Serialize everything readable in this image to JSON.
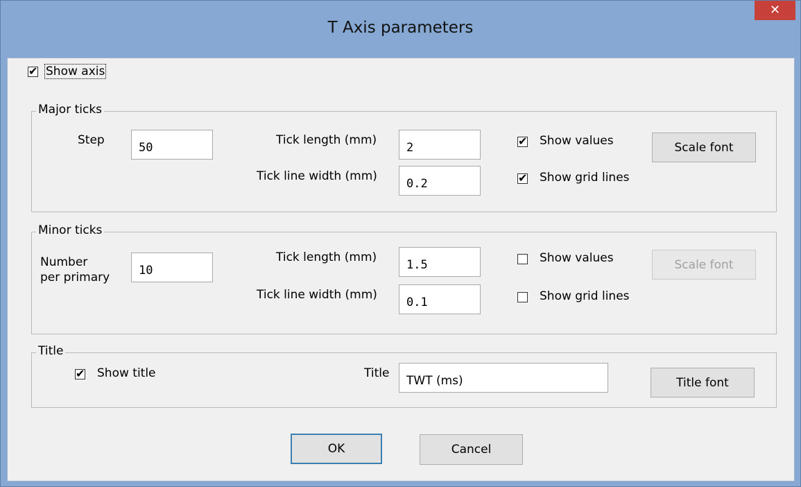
{
  "window": {
    "title": "T Axis parameters",
    "close_glyph": "✕"
  },
  "show_axis": {
    "label": "Show axis",
    "checked": true
  },
  "major": {
    "legend": "Major ticks",
    "step_label": "Step",
    "step_value": "50",
    "tick_length_label": "Tick length (mm)",
    "tick_length_value": "2",
    "tick_width_label": "Tick line width (mm)",
    "tick_width_value": "0.2",
    "show_values_label": "Show values",
    "show_values_checked": true,
    "show_grid_label": "Show grid lines",
    "show_grid_checked": true,
    "font_button": "Scale font"
  },
  "minor": {
    "legend": "Minor ticks",
    "number_label_1": "Number",
    "number_label_2": "per primary",
    "number_value": "10",
    "tick_length_label": "Tick length (mm)",
    "tick_length_value": "1.5",
    "tick_width_label": "Tick line width (mm)",
    "tick_width_value": "0.1",
    "show_values_label": "Show values",
    "show_values_checked": false,
    "show_grid_label": "Show grid lines",
    "show_grid_checked": false,
    "font_button": "Scale font"
  },
  "title_group": {
    "legend": "Title",
    "show_title_label": "Show title",
    "show_title_checked": true,
    "title_label": "Title",
    "title_value": "TWT (ms)",
    "font_button": "Title font"
  },
  "buttons": {
    "ok": "OK",
    "cancel": "Cancel"
  },
  "check_glyph": "✔"
}
